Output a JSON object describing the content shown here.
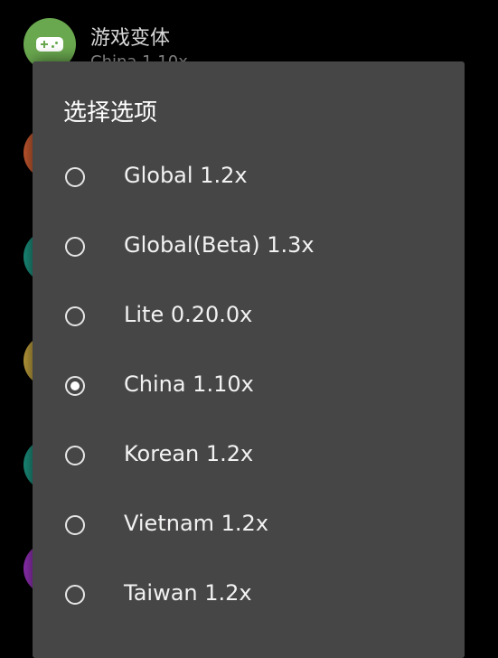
{
  "background_list": {
    "first_item": {
      "title": "游戏变体",
      "subtitle": "China 1.10x",
      "icon_color": "#6aa84f",
      "icon": "gamepad-icon"
    },
    "peek_icon_colors": [
      "#c0562e",
      "#1a8b78",
      "#b89a3a",
      "#1a8b78",
      "#8e2fb0"
    ]
  },
  "dialog": {
    "title": "选择选项",
    "options": [
      {
        "label": "Global 1.2x",
        "checked": false
      },
      {
        "label": "Global(Beta) 1.3x",
        "checked": false
      },
      {
        "label": "Lite 0.20.0x",
        "checked": false
      },
      {
        "label": "China 1.10x",
        "checked": true
      },
      {
        "label": "Korean 1.2x",
        "checked": false
      },
      {
        "label": "Vietnam 1.2x",
        "checked": false
      },
      {
        "label": "Taiwan 1.2x",
        "checked": false
      }
    ]
  }
}
